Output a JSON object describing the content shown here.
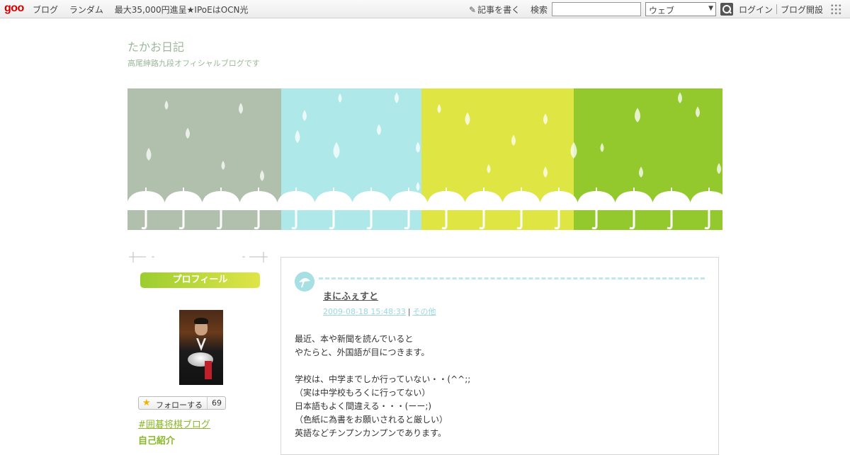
{
  "topbar": {
    "logo": "goo",
    "nav": [
      "ブログ",
      "ランダム",
      "最大35,000円進呈★IPoEはOCN光"
    ],
    "write_label": "記事を書く",
    "search_label": "検索",
    "search_value": "",
    "search_select": "ウェブ",
    "login": "ログイン",
    "open_blog": "ブログ開設"
  },
  "blog": {
    "title": "たかお日記",
    "subtitle": "高尾紳路九段オフィシャルブログです"
  },
  "banner": {
    "colors": [
      "#b1bfad",
      "#aee8e8",
      "#dfe644",
      "#93c92c"
    ]
  },
  "sidebar": {
    "profile_header": "プロフィール",
    "follow_label": "フォローする",
    "follow_count": "69",
    "tag_link": "#囲碁将棋ブログ",
    "self_intro": "自己紹介"
  },
  "entry": {
    "title": "まにふぇすと",
    "date": "2009-08-18 15:48:33",
    "category": "その他",
    "body": [
      "最近、本や新聞を読んでいると",
      "やたらと、外国語が目につきます。",
      "",
      "学校は、中学までしか行っていない・・(^^;;",
      "（実は中学校もろくに行ってない）",
      "日本語もよく間違える・・・(ーー;)",
      "（色紙に為書をお願いされると厳しい）",
      "英語などチンプンカンプンであります。"
    ]
  }
}
